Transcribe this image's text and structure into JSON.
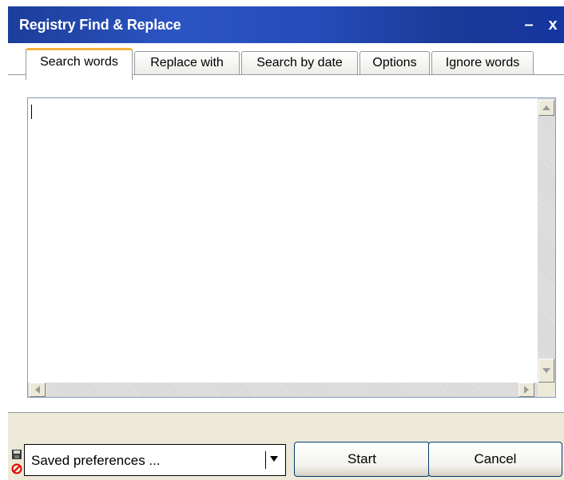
{
  "window": {
    "title": "Registry Find & Replace",
    "minimize_glyph": "–",
    "close_glyph": "x"
  },
  "tabs": [
    {
      "label": "Search words",
      "active": true
    },
    {
      "label": "Replace with",
      "active": false
    },
    {
      "label": "Search by date",
      "active": false
    },
    {
      "label": "Options",
      "active": false
    },
    {
      "label": "Ignore words",
      "active": false
    }
  ],
  "editor": {
    "value": ""
  },
  "bottom": {
    "preferences_value": "Saved preferences ...",
    "start_label": "Start",
    "cancel_label": "Cancel",
    "icons": [
      "save-icon",
      "delete-icon"
    ]
  },
  "colors": {
    "titlebar": "#2b55c3",
    "active_tab_accent": "#f5b23b",
    "frame": "#ECE9D8"
  }
}
